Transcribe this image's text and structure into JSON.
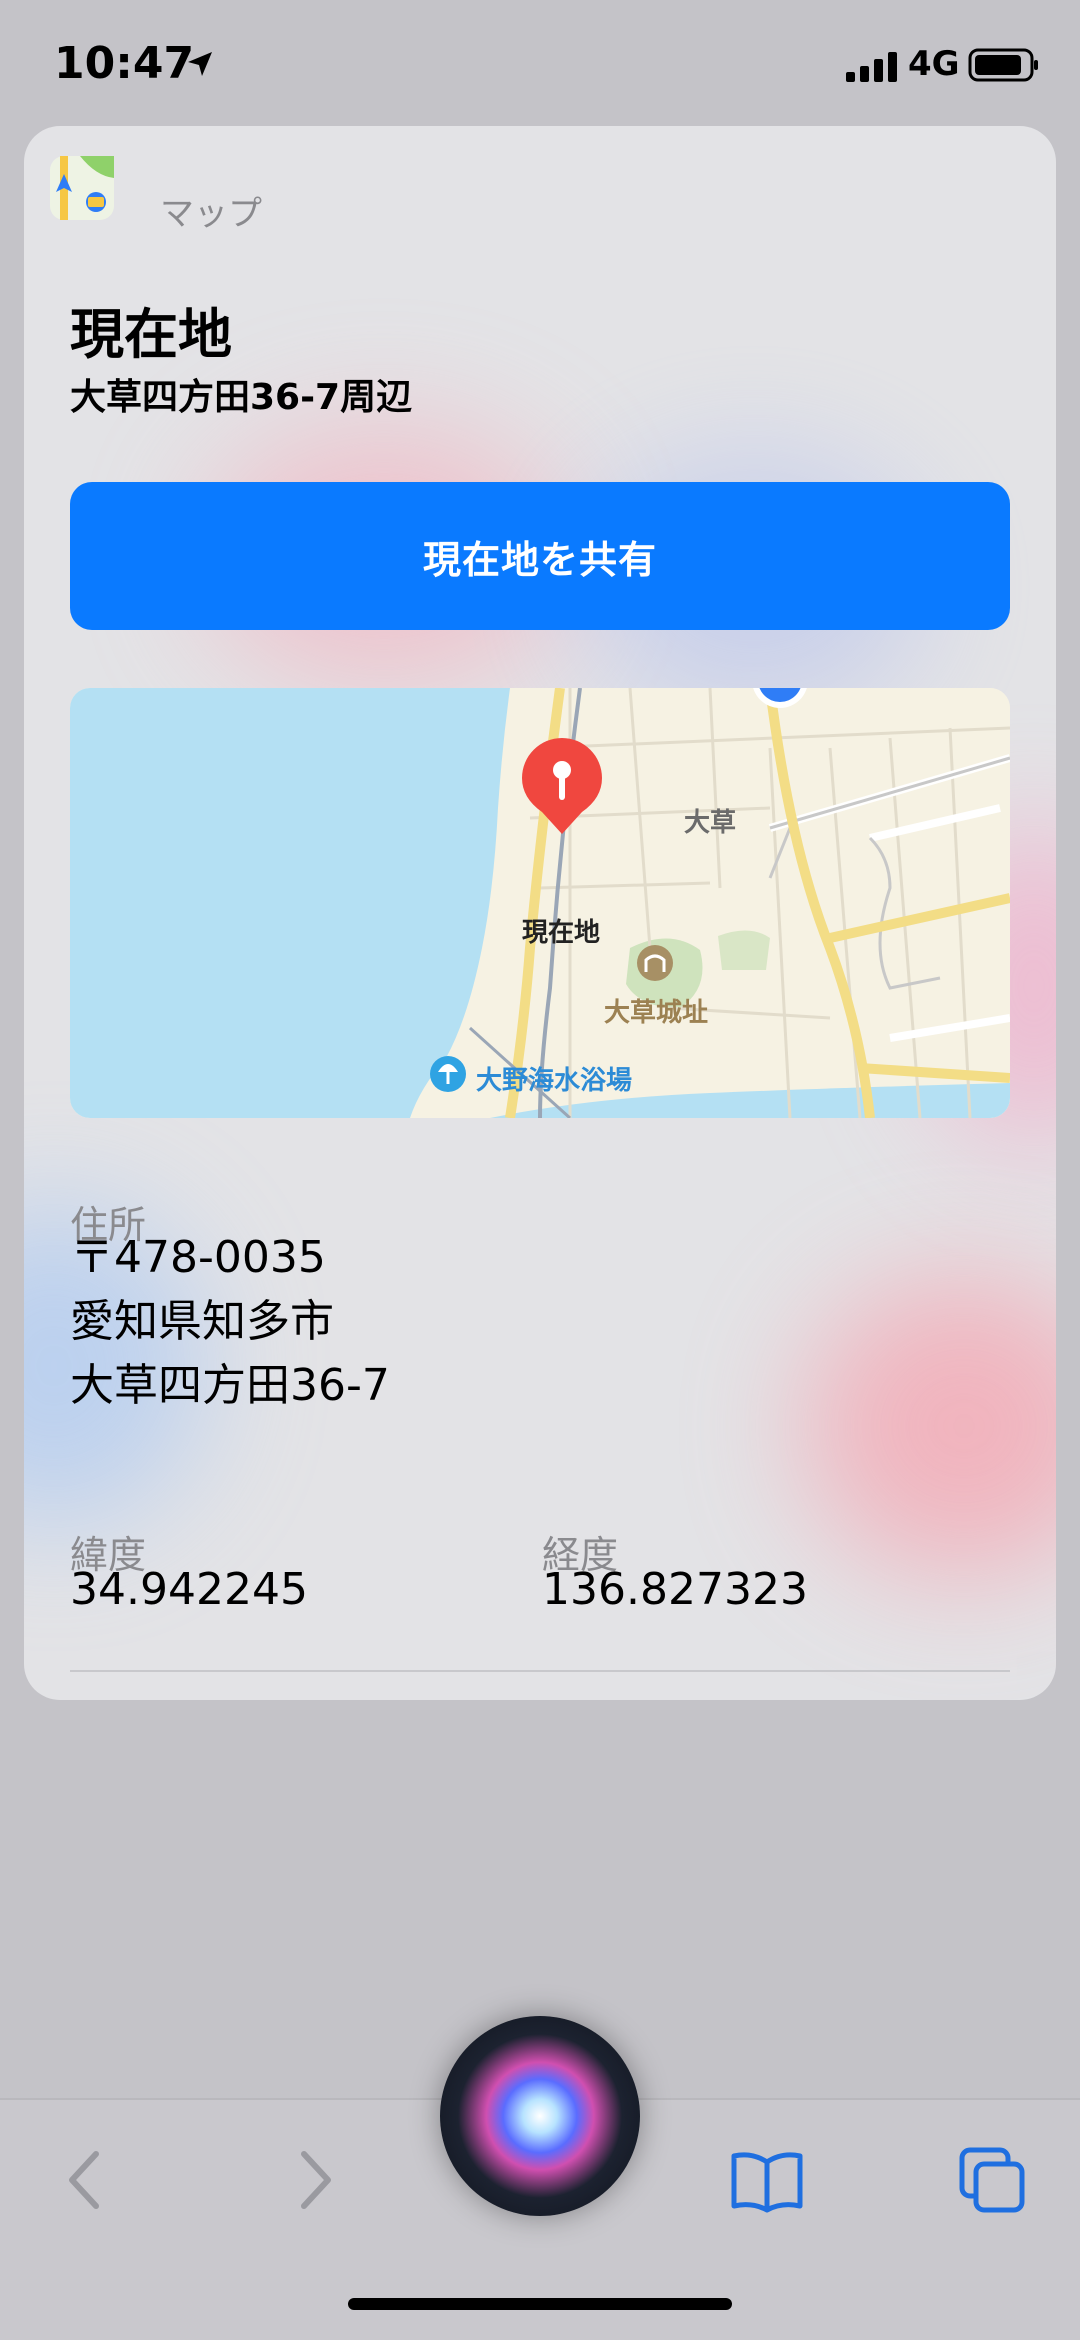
{
  "status_bar": {
    "time": "10:47",
    "network": "4G"
  },
  "card": {
    "app_name": "マップ",
    "title": "現在地",
    "subtitle": "大草四方田36-7周辺",
    "share_button": "現在地を共有",
    "map": {
      "pin_label": "現在地",
      "area_label": "大草",
      "castle_label": "大草城址",
      "beach_label": "大野海水浴場"
    },
    "address": {
      "label": "住所",
      "lines": [
        "〒478-0035",
        "愛知県知多市",
        "大草四方田36-7"
      ]
    },
    "latitude": {
      "label": "緯度",
      "value": "34.942245"
    },
    "longitude": {
      "label": "経度",
      "value": "136.827323"
    }
  },
  "colors": {
    "accent": "#0a7aff",
    "pin": "#f0473f",
    "water": "#b4e0f3"
  },
  "icons": [
    "location-arrow-icon",
    "signal-icon",
    "battery-icon",
    "maps-app-icon",
    "back-icon",
    "forward-icon",
    "siri-icon",
    "bookmarks-icon",
    "tabs-icon"
  ]
}
